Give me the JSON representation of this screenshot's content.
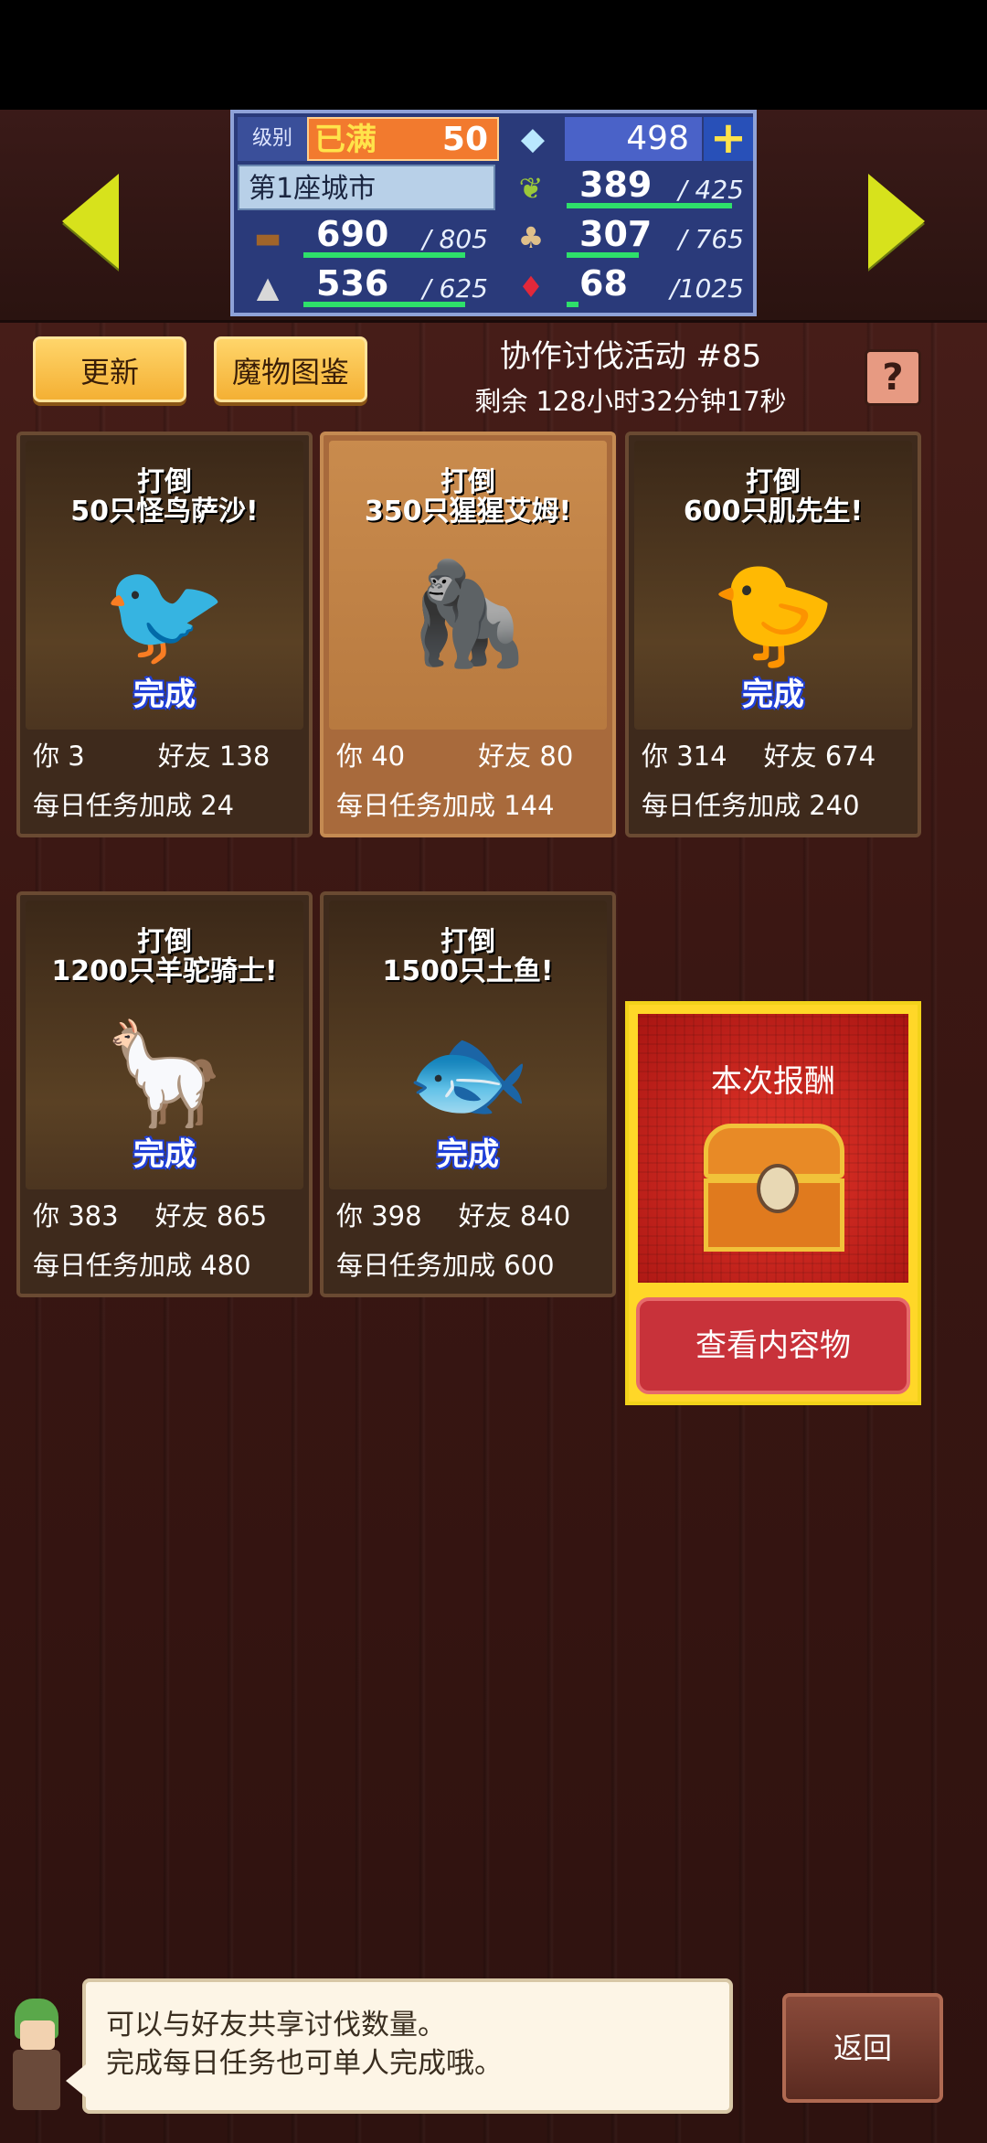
{
  "hud": {
    "level_label": "级别",
    "level_status": "已满",
    "level_value": "50",
    "gems": "498",
    "plus_symbol": "+",
    "city_name": "第1座城市",
    "resources": [
      {
        "icon": "wood-icon",
        "value": "690",
        "max": "/ 805",
        "fill": 0.857
      },
      {
        "icon": "wheat-icon",
        "value": "389",
        "max": "/ 425",
        "fill": 0.915
      },
      {
        "icon": "food-icon",
        "value": "307",
        "max": "/ 765",
        "fill": 0.401
      },
      {
        "icon": "ore-icon",
        "value": "536",
        "max": "/ 625",
        "fill": 0.858
      },
      {
        "icon": "ruby-icon",
        "value": "68",
        "max": "/1025",
        "fill": 0.066
      }
    ]
  },
  "toolbar": {
    "refresh": "更新",
    "bestiary": "魔物图鉴",
    "event_title": "协作讨伐活动 #85",
    "event_remaining": "剩余 128小时32分钟17秒",
    "help": "?"
  },
  "labels": {
    "you": "你",
    "friend": "好友",
    "daily_bonus": "每日任务加成",
    "done": "完成"
  },
  "cards": [
    {
      "line1": "打倒",
      "line2": "50只怪鸟萨沙!",
      "you": "3",
      "friend": "138",
      "bonus": "24",
      "monster": "bird",
      "highlight": false
    },
    {
      "line1": "打倒",
      "line2": "350只猩猩艾姆!",
      "you": "40",
      "friend": "80",
      "bonus": "144",
      "monster": "gorilla",
      "highlight": true
    },
    {
      "line1": "打倒",
      "line2": "600只肌先生!",
      "you": "314",
      "friend": "674",
      "bonus": "240",
      "monster": "muscle",
      "highlight": false
    },
    {
      "line1": "打倒",
      "line2": "1200只羊驼骑士!",
      "you": "383",
      "friend": "865",
      "bonus": "480",
      "monster": "alpaca-knight",
      "highlight": false
    },
    {
      "line1": "打倒",
      "line2": "1500只土鱼!",
      "you": "398",
      "friend": "840",
      "bonus": "600",
      "monster": "mudfish",
      "highlight": false
    }
  ],
  "reward": {
    "title": "本次报酬",
    "view_button": "查看内容物"
  },
  "dialog": {
    "line1": "可以与好友共享讨伐数量。",
    "line2": "完成每日任务也可单人完成哦。"
  },
  "back_button": "返回"
}
